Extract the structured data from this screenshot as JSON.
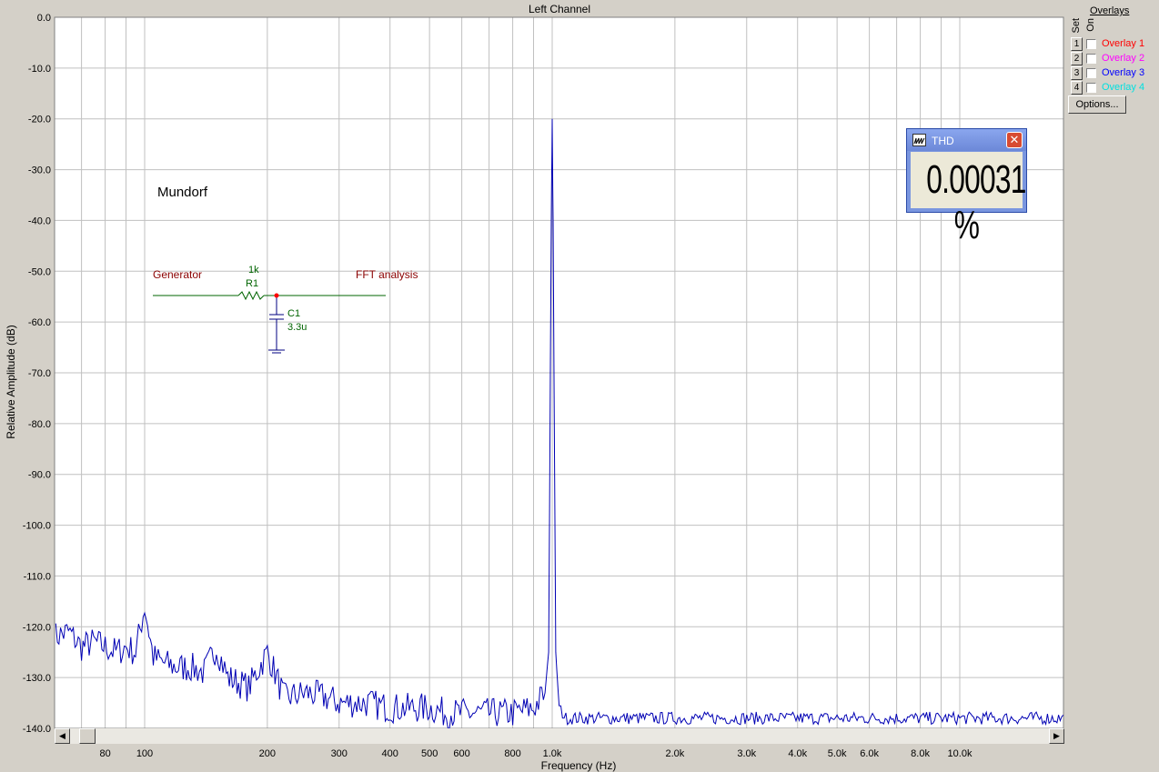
{
  "chart_data": {
    "type": "line",
    "title": "Left Channel",
    "xlabel": "Frequency (Hz)",
    "ylabel": "Relative Amplitude (dB)",
    "x_scale": "log",
    "xlim": [
      60,
      20000
    ],
    "ylim": [
      -140,
      0
    ],
    "grid": true,
    "y_ticks": [
      0,
      -10,
      -20,
      -30,
      -40,
      -50,
      -60,
      -70,
      -80,
      -90,
      -100,
      -110,
      -120,
      -130,
      -140
    ],
    "y_tick_labels": [
      "0.0",
      "-10.0",
      "-20.0",
      "-30.0",
      "-40.0",
      "-50.0",
      "-60.0",
      "-70.0",
      "-80.0",
      "-90.0",
      "-100.0",
      "-110.0",
      "-120.0",
      "-130.0",
      "-140.0"
    ],
    "x_ticks": [
      80,
      100,
      200,
      300,
      400,
      500,
      600,
      800,
      1000,
      2000,
      3000,
      4000,
      5000,
      6000,
      8000,
      10000
    ],
    "x_tick_labels": [
      "80",
      "100",
      "200",
      "300",
      "400",
      "500",
      "600",
      "800",
      "1.0k",
      "2.0k",
      "3.0k",
      "4.0k",
      "5.0k",
      "6.0k",
      "8.0k",
      "10.0k"
    ],
    "series": [
      {
        "color": "#0000b4",
        "x": [
          60,
          65,
          70,
          75,
          80,
          85,
          90,
          95,
          100,
          105,
          110,
          120,
          130,
          140,
          150,
          160,
          170,
          180,
          200,
          220,
          250,
          280,
          300,
          320,
          350,
          400,
          450,
          500,
          550,
          600,
          700,
          800,
          900,
          960,
          980,
          995,
          1000,
          1005,
          1020,
          1040,
          1080,
          1200,
          1500,
          2000,
          3000,
          4000,
          5000,
          6000,
          8000,
          10000,
          15000,
          20000
        ],
        "y": [
          -122,
          -121,
          -124,
          -123,
          -124,
          -125,
          -124,
          -125,
          -116,
          -126,
          -127,
          -128,
          -128,
          -129,
          -124,
          -130,
          -131,
          -132,
          -125,
          -134,
          -133,
          -134,
          -135,
          -135,
          -135,
          -136,
          -136,
          -136,
          -137,
          -137,
          -137,
          -137,
          -136,
          -133,
          -125,
          -40,
          -20,
          -40,
          -125,
          -136,
          -138,
          -138,
          -138,
          -138,
          -138,
          -138,
          -138,
          -138,
          -138,
          -138,
          -138,
          -138
        ]
      }
    ]
  },
  "annotations": {
    "device_name": "Mundorf",
    "generator_label": "Generator",
    "fft_label": "FFT analysis",
    "r_value": "1k",
    "r_name": "R1",
    "c_name": "C1",
    "c_value": "3.3u"
  },
  "overlays": {
    "header": "Overlays",
    "set_label": "Set",
    "on_label": "On",
    "items": [
      {
        "num": "1",
        "label": "Overlay 1",
        "color": "#ff0000"
      },
      {
        "num": "2",
        "label": "Overlay 2",
        "color": "#ff00ff"
      },
      {
        "num": "3",
        "label": "Overlay 3",
        "color": "#0000ff"
      },
      {
        "num": "4",
        "label": "Overlay 4",
        "color": "#00e0e0"
      }
    ],
    "options_label": "Options..."
  },
  "thd": {
    "title": "THD",
    "value": "0.00031 %"
  },
  "colors": {
    "plot_bg": "#ffffff",
    "grid": "#c0c0c0",
    "trace": "#0000b4",
    "schematic_green": "#006400",
    "schematic_red": "#8b0000"
  }
}
